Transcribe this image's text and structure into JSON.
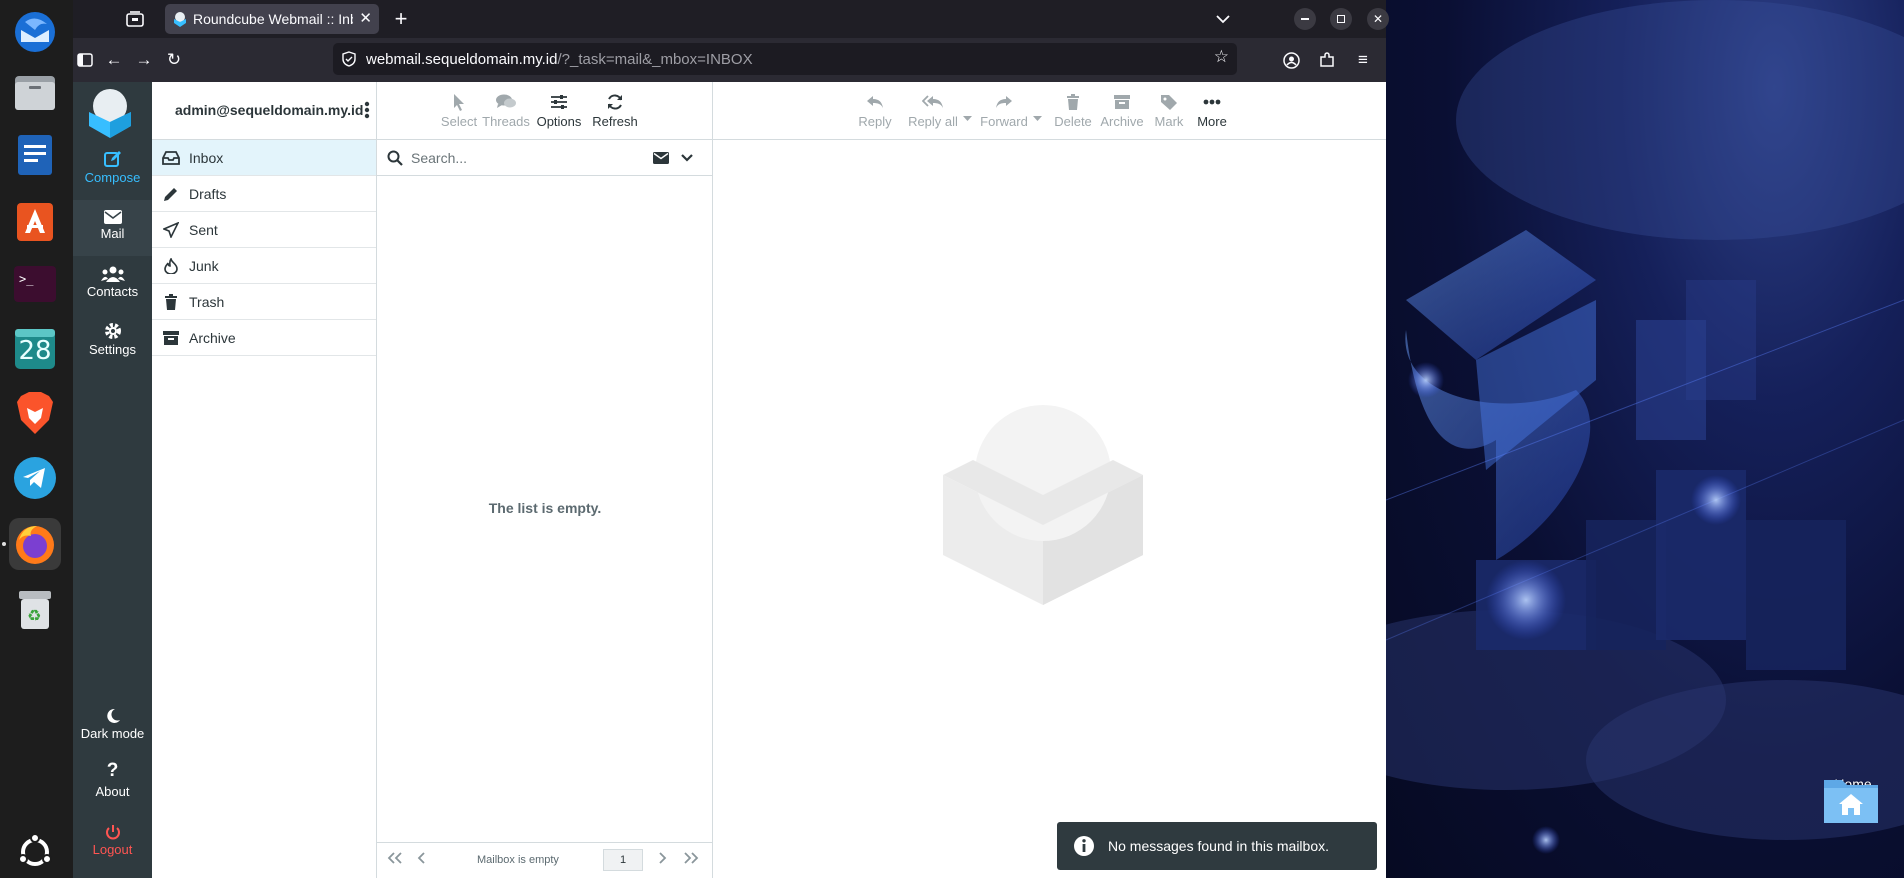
{
  "browser": {
    "tab_title": "Roundcube Webmail :: Inbox",
    "url_host": "webmail.sequeldomain.my.id",
    "url_path": "/?_task=mail&_mbox=INBOX"
  },
  "taskmenu": {
    "compose": "Compose",
    "mail": "Mail",
    "contacts": "Contacts",
    "settings": "Settings",
    "dark_mode": "Dark mode",
    "about": "About",
    "logout": "Logout"
  },
  "account": {
    "username": "admin@sequeldomain.my.id"
  },
  "folders": [
    {
      "label": "Inbox",
      "icon": "inbox-icon"
    },
    {
      "label": "Drafts",
      "icon": "pencil-icon"
    },
    {
      "label": "Sent",
      "icon": "paper-plane-icon"
    },
    {
      "label": "Junk",
      "icon": "fire-icon"
    },
    {
      "label": "Trash",
      "icon": "trash-icon"
    },
    {
      "label": "Archive",
      "icon": "archive-icon"
    }
  ],
  "list_toolbar": {
    "select": "Select",
    "threads": "Threads",
    "options": "Options",
    "refresh": "Refresh"
  },
  "search": {
    "placeholder": "Search..."
  },
  "message_list": {
    "empty_text": "The list is empty.",
    "footer_status": "Mailbox is empty",
    "page": "1"
  },
  "message_toolbar": {
    "reply": "Reply",
    "reply_all": "Reply all",
    "forward": "Forward",
    "delete": "Delete",
    "archive": "Archive",
    "mark": "Mark",
    "more": "More"
  },
  "toast": {
    "text": "No messages found in this mailbox."
  },
  "desktop": {
    "home_label": "Home",
    "calendar_day": "28"
  },
  "colors": {
    "accent": "#37beff",
    "taskmenu_bg": "#2f3a3f",
    "logout": "#ff5552"
  }
}
